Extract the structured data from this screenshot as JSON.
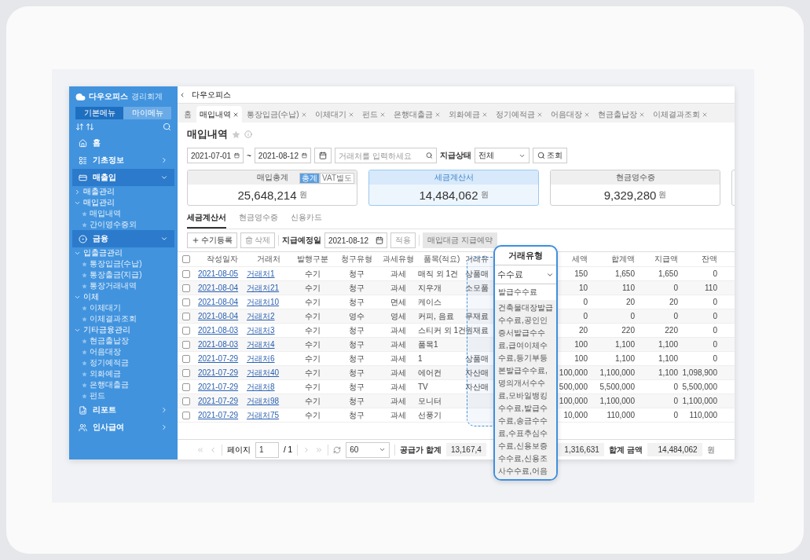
{
  "sidebar": {
    "logo": "다우오피스",
    "logo_sub": "경리회계",
    "menu_toggle": [
      {
        "label": "기본메뉴",
        "selected": true
      },
      {
        "label": "마이메뉴",
        "selected": false
      }
    ],
    "items": [
      {
        "label": "홈",
        "kind": "home"
      },
      {
        "label": "기초정보",
        "kind": "info"
      },
      {
        "label": "매출입",
        "kind": "card",
        "expanded": true,
        "children": [
          {
            "label": "매출관리",
            "expanded": false
          },
          {
            "label": "매입관리",
            "expanded": true,
            "children": [
              {
                "label": "매입내역"
              },
              {
                "label": "간이영수증외"
              }
            ]
          }
        ]
      },
      {
        "label": "금융",
        "kind": "finance",
        "expanded": true,
        "children": [
          {
            "label": "입출금관리",
            "expanded": true,
            "children": [
              {
                "label": "통장입금(수납)"
              },
              {
                "label": "통장출금(지급)"
              },
              {
                "label": "통장거래내역"
              }
            ]
          },
          {
            "label": "이체",
            "expanded": true,
            "children": [
              {
                "label": "이체대기"
              },
              {
                "label": "이체결과조회"
              }
            ]
          },
          {
            "label": "기타금융관리",
            "expanded": true,
            "children": [
              {
                "label": "현금출납장"
              },
              {
                "label": "어음대장"
              },
              {
                "label": "정기예적금"
              },
              {
                "label": "외화예금"
              },
              {
                "label": "은행대출금"
              },
              {
                "label": "펀드"
              }
            ]
          }
        ]
      },
      {
        "label": "리포트",
        "kind": "report"
      },
      {
        "label": "인사급여",
        "kind": "people"
      }
    ]
  },
  "breadcrumb": "다우오피스",
  "tabs": [
    {
      "label": "홈",
      "selected": false,
      "closable": false
    },
    {
      "label": "매입내역",
      "selected": true,
      "closable": true
    },
    {
      "label": "통장입금(수납)",
      "selected": false,
      "closable": true
    },
    {
      "label": "이체대기",
      "selected": false,
      "closable": true
    },
    {
      "label": "펀드",
      "selected": false,
      "closable": true
    },
    {
      "label": "은행대출금",
      "selected": false,
      "closable": true
    },
    {
      "label": "외화예금",
      "selected": false,
      "closable": true
    },
    {
      "label": "정기예적금",
      "selected": false,
      "closable": true
    },
    {
      "label": "어음대장",
      "selected": false,
      "closable": true
    },
    {
      "label": "현금출납장",
      "selected": false,
      "closable": true
    },
    {
      "label": "이체결과조회",
      "selected": false,
      "closable": true
    }
  ],
  "page_title": "매입내역",
  "filter": {
    "date_from": "2021-07-01",
    "separator": "~",
    "date_to": "2021-08-12",
    "search_placeholder": "거래처를 입력하세요",
    "status_label": "지급상태",
    "status_value": "전체",
    "search_button": "조회"
  },
  "summary_cards": [
    {
      "title": "매입총계",
      "amount": "25,648,214",
      "unit": "원",
      "selected": false,
      "badges": [
        {
          "label": "총계",
          "selected": true
        },
        {
          "label": "VAT별도",
          "selected": false
        }
      ]
    },
    {
      "title": "세금계산서",
      "amount": "14,484,062",
      "unit": "원",
      "selected": true
    },
    {
      "title": "현금영수증",
      "amount": "9,329,280",
      "unit": "원",
      "selected": false
    }
  ],
  "sub_tabs": [
    {
      "label": "세금계산서",
      "selected": true
    },
    {
      "label": "현금영수증",
      "selected": false
    },
    {
      "label": "신용카드",
      "selected": false
    }
  ],
  "toolbar": {
    "add": "수기등록",
    "delete": "삭제",
    "due_label": "지급예정일",
    "due_date": "2021-08-12",
    "apply": "적용",
    "reserve": "매입대금 지급예약",
    "reserve_disabled": true
  },
  "table": {
    "select_all_checked": false,
    "columns": [
      {
        "label": "작성일자",
        "kind": "link"
      },
      {
        "label": "거래처",
        "kind": "link"
      },
      {
        "label": "발행구분",
        "kind": "text"
      },
      {
        "label": "청구유형",
        "kind": "text"
      },
      {
        "label": "과세유형",
        "kind": "text"
      },
      {
        "label": "품목(적요)",
        "kind": "left"
      },
      {
        "label": "거래유",
        "kind": "partial"
      },
      {
        "label": "세액",
        "kind": "num"
      },
      {
        "label": "합계액",
        "kind": "num"
      },
      {
        "label": "지급액",
        "kind": "num"
      },
      {
        "label": "잔액",
        "kind": "num"
      }
    ],
    "rows": [
      {
        "checked": false,
        "cells": [
          "2021-08-05",
          "거래처1",
          "수기",
          "청구",
          "과세",
          "매직 외 1건",
          "상품매",
          "150",
          "1,650",
          "1,650",
          "0"
        ]
      },
      {
        "checked": false,
        "cells": [
          "2021-08-04",
          "거래처21",
          "수기",
          "청구",
          "과세",
          "지우개",
          "소모품",
          "10",
          "110",
          "0",
          "110"
        ]
      },
      {
        "checked": false,
        "cells": [
          "2021-08-04",
          "거래처10",
          "수기",
          "청구",
          "면세",
          "케이스",
          null,
          "0",
          "20",
          "20",
          "0"
        ]
      },
      {
        "checked": false,
        "cells": [
          "2021-08-04",
          "거래처2",
          "수기",
          "영수",
          "영세",
          "커피, 음료",
          "무재료",
          "0",
          "0",
          "0",
          "0"
        ]
      },
      {
        "checked": false,
        "cells": [
          "2021-08-03",
          "거래처3",
          "수기",
          "청구",
          "과세",
          "스티커 외 1건",
          "원재료",
          "20",
          "220",
          "220",
          "0"
        ]
      },
      {
        "checked": false,
        "cells": [
          "2021-08-03",
          "거래처4",
          "수기",
          "청구",
          "과세",
          "품목1",
          null,
          "100",
          "1,100",
          "1,100",
          "0"
        ]
      },
      {
        "checked": false,
        "cells": [
          "2021-07-29",
          "거래처6",
          "수기",
          "청구",
          "과세",
          "1",
          "상품매",
          "100",
          "1,100",
          "1,100",
          "0"
        ]
      },
      {
        "checked": false,
        "cells": [
          "2021-07-29",
          "거래처40",
          "수기",
          "청구",
          "과세",
          "에어컨",
          "자산매",
          "100,000",
          "1,100,000",
          "1,100",
          "1,098,900"
        ]
      },
      {
        "checked": false,
        "cells": [
          "2021-07-29",
          "거래처8",
          "수기",
          "청구",
          "과세",
          "TV",
          "자산매",
          "500,000",
          "5,500,000",
          "0",
          "5,500,000"
        ]
      },
      {
        "checked": false,
        "cells": [
          "2021-07-29",
          "거래처98",
          "수기",
          "청구",
          "과세",
          "모니터",
          null,
          "100,000",
          "1,100,000",
          "0",
          "1,100,000"
        ]
      },
      {
        "checked": false,
        "cells": [
          "2021-07-29",
          "거래처75",
          "수기",
          "청구",
          "과세",
          "선풍기",
          null,
          "10,000",
          "110,000",
          "0",
          "110,000"
        ]
      }
    ]
  },
  "footer": {
    "page_label": "페이지",
    "page": "1",
    "page_total": "/ 1",
    "page_size": "60",
    "supply_label": "공급가 합계",
    "supply_total": "13,167,4",
    "tax_total": "1,316,631",
    "sum_label": "합계 금액",
    "sum_total": "14,484,062",
    "unit": "원"
  },
  "popup": {
    "title": "거래유형",
    "value": "수수료",
    "options": [
      {
        "label": "발급수수료",
        "selected": false
      },
      {
        "label": "건축물대장발급수수료,공인인증서발급수수료,급여이체수수료,등기부등본발급수수료,명의개서수수료,모바일뱅킹수수료,발급수수료,송금수수료,수표추심수수료,신용보증수수료,신용조사수수료,어음",
        "selected": true
      }
    ]
  }
}
